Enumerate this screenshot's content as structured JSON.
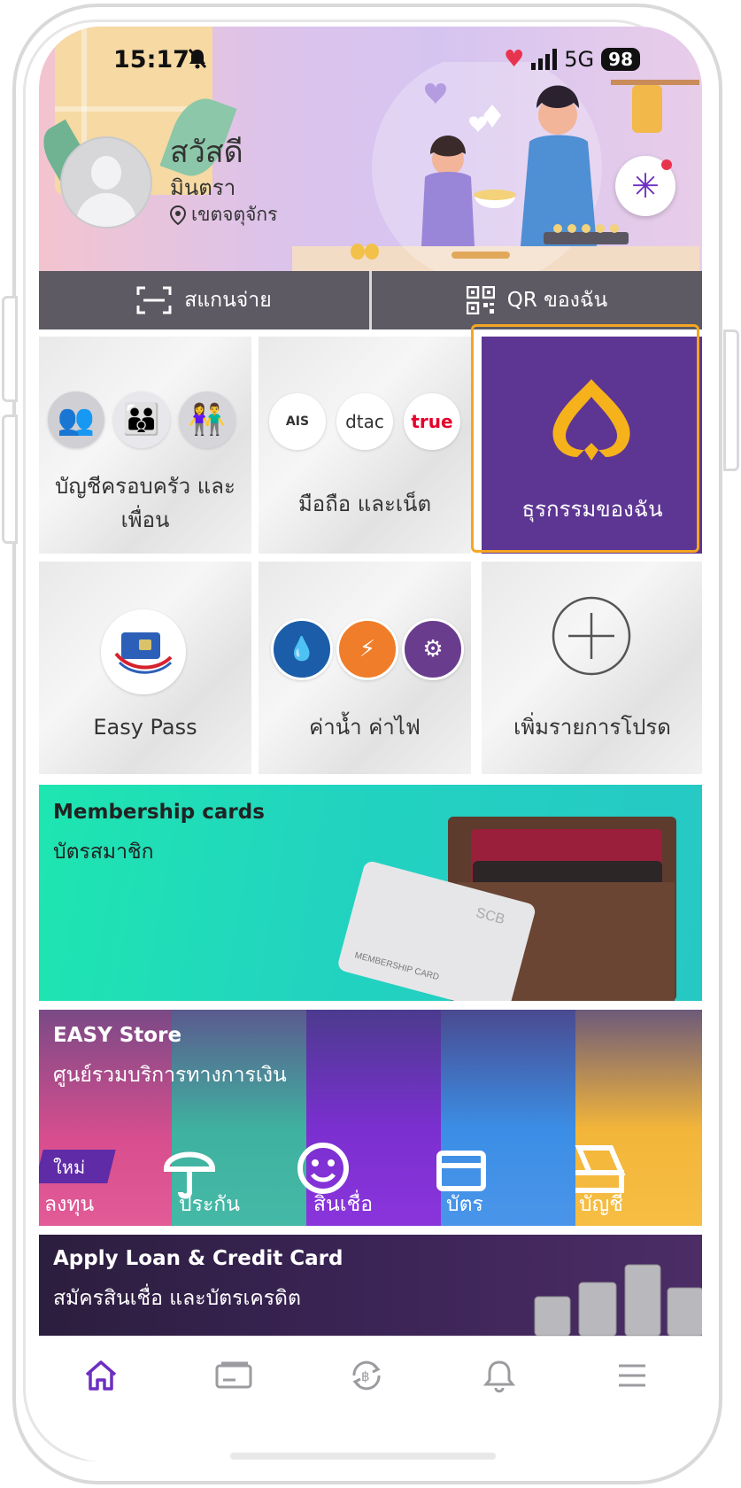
{
  "status_bar": {
    "time": "15:17",
    "network": "5G",
    "battery": "98"
  },
  "header": {
    "greeting": "สวัสดี",
    "user_name": "มินตรา",
    "location": "เขตจตุจักร"
  },
  "quick_actions": {
    "scan_pay": "สแกนจ่าย",
    "my_qr": "QR ของฉัน"
  },
  "tiles": {
    "family": "บัญชีครอบครัว และเพื่อน",
    "mobile": "มือถือ และเน็ต",
    "mobile_operators": [
      "AIS",
      "dtac",
      "true"
    ],
    "my_business": "ธุรกรรมของฉัน",
    "easy_pass": "Easy Pass",
    "utilities": "ค่าน้ำ ค่าไฟ",
    "add_favorite": "เพิ่มรายการโปรด"
  },
  "membership": {
    "title": "Membership cards",
    "subtitle": "บัตรสมาชิก",
    "card_brand": "SCB",
    "card_text": "MEMBERSHIP CARD"
  },
  "easy_store": {
    "title": "EASY Store",
    "subtitle": "ศูนย์รวมบริการทางการเงิน",
    "new_badge": "ใหม่",
    "items": [
      "ลงทุน",
      "ประกัน",
      "สินเชื่อ",
      "บัตร",
      "บัญชี"
    ]
  },
  "loan": {
    "title": "Apply Loan & Credit Card",
    "subtitle": "สมัครสินเชื่อ และบัตรเครดิต"
  },
  "colors": {
    "brand_purple": "#5d3593",
    "highlight": "#f5a623",
    "nav_active": "#6d2fc1"
  },
  "bottom_nav": [
    "home-icon",
    "wallet-card-icon",
    "baht-exchange-icon",
    "bell-icon",
    "menu-icon"
  ]
}
